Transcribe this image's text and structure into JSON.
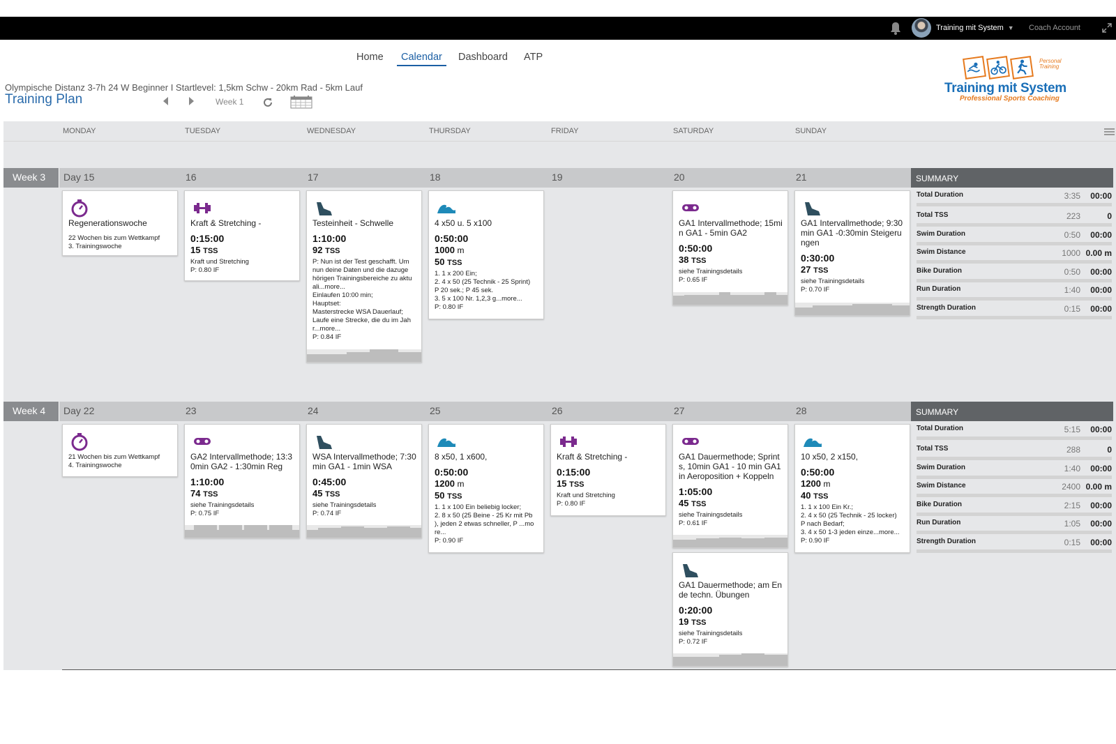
{
  "topbar": {
    "user_name": "Training mit System",
    "user_caret": "▼",
    "coach_link": "Coach Account",
    "icons": [
      "bell-icon",
      "expand-icon"
    ]
  },
  "nav": {
    "items": [
      "Home",
      "Calendar",
      "Dashboard",
      "ATP"
    ],
    "active": "Calendar"
  },
  "plan": {
    "subtitle": "Olympische Distanz 3-7h 24 W Beginner I Startlevel: 1,5km Schw - 20km Rad - 5km Lauf",
    "title": "Training Plan",
    "week_label": "Week 1"
  },
  "logo": {
    "text": "Training mit System",
    "tagline": "Professional Sports Coaching",
    "badge": "Personal\nTraining"
  },
  "colors": {
    "accent": "#1b5fa4",
    "strength": "#7b2a8e",
    "recovery": "#7b2a8e",
    "bike": "#7b2a8e",
    "run": "#2f4f5f",
    "swim": "#1e8ab8"
  },
  "days": [
    "MONDAY",
    "TUESDAY",
    "WEDNESDAY",
    "THURSDAY",
    "FRIDAY",
    "SATURDAY",
    "SUNDAY"
  ],
  "summary_label": "SUMMARY",
  "weeks": [
    {
      "label": "Week 3",
      "day_labels": [
        "Day 15",
        "16",
        "17",
        "18",
        "19",
        "20",
        "21"
      ],
      "cards": [
        {
          "day": 0,
          "icon": "stopwatch-icon",
          "title": "Regenerationswoche",
          "note": "22 Wochen bis zum Wettkampf\n3. Trainingswoche"
        },
        {
          "day": 1,
          "icon": "dumbbell-icon",
          "title": "Kraft & Stretching -",
          "duration": "0:15:00",
          "tss": "15",
          "tss_unit": "TSS",
          "desc": "Kraft und Stretching",
          "if": "P: 0.80 IF"
        },
        {
          "day": 2,
          "icon": "running-shoe-icon",
          "title": "Testeinheit - Schwelle",
          "duration": "1:10:00",
          "tss": "92",
          "tss_unit": "TSS",
          "desc": "P: Nun ist der Test geschafft. Um\nnun deine Daten und die dazuge\nhörigen Trainingsbereiche zu aktu\nali...more...\nEinlaufen 10:00 min;\nHauptset:\nMasterstrecke WSA Dauerlauf;\nLaufe eine Strecke, die du im Jah\nr...more...",
          "if": "P: 0.84 IF",
          "profile": [
            [
              0,
              0.6
            ],
            [
              0.35,
              0.8
            ],
            [
              0.55,
              1
            ],
            [
              0.8,
              0.8
            ]
          ]
        },
        {
          "day": 3,
          "icon": "swim-wave-icon",
          "title": "4 x50 u. 5 x100",
          "duration": "0:50:00",
          "value": "1000",
          "value_unit": "m",
          "tss": "50",
          "tss_unit": "TSS",
          "desc": "1. 1 x 200 Ein;\n2. 4 x 50 (25 Technik - 25 Sprint)\nP 20 sek.; P 45 sek.\n3. 5 x 100 Nr. 1,2,3 g...more...",
          "if": "P: 0.80 IF"
        },
        {
          "day": 5,
          "icon": "bike-chain-icon",
          "title": "GA1 Intervallmethode; 15mi\nn GA1 - 5min GA2",
          "duration": "0:50:00",
          "tss": "38",
          "tss_unit": "TSS",
          "desc": "siehe Trainingsdetails",
          "if": "P: 0.65 IF",
          "profile": [
            [
              0,
              0.7
            ],
            [
              0.1,
              0.8
            ],
            [
              0.4,
              1
            ],
            [
              0.5,
              0.8
            ],
            [
              0.8,
              1
            ],
            [
              0.9,
              0.8
            ]
          ]
        },
        {
          "day": 6,
          "icon": "running-shoe-icon",
          "title": "GA1 Intervallmethode; 9:30\nmin GA1 -0:30min Steigeru\nngen",
          "duration": "0:30:00",
          "tss": "27",
          "tss_unit": "TSS",
          "desc": "siehe Trainingsdetails",
          "if": "P: 0.70 IF",
          "profile": [
            [
              0,
              0.6
            ],
            [
              0.15,
              0.8
            ],
            [
              0.5,
              0.9
            ],
            [
              0.85,
              0.8
            ]
          ]
        }
      ],
      "summary": [
        {
          "label": "Total Duration",
          "planned": "3:35",
          "actual": "00:00"
        },
        {
          "label": "Total TSS",
          "planned": "223",
          "actual": "0"
        },
        {
          "label": "Swim Duration",
          "planned": "0:50",
          "actual": "00:00"
        },
        {
          "label": "Swim Distance",
          "planned": "1000",
          "actual": "0.00 m"
        },
        {
          "label": "Bike Duration",
          "planned": "0:50",
          "actual": "00:00"
        },
        {
          "label": "Run Duration",
          "planned": "1:40",
          "actual": "00:00"
        },
        {
          "label": "Strength Duration",
          "planned": "0:15",
          "actual": "00:00"
        }
      ]
    },
    {
      "label": "Week 4",
      "day_labels": [
        "Day 22",
        "23",
        "24",
        "25",
        "26",
        "27",
        "28"
      ],
      "cards": [
        {
          "day": 0,
          "icon": "stopwatch-icon",
          "title": "",
          "note": "21 Wochen bis zum Wettkampf\n4. Trainingswoche"
        },
        {
          "day": 1,
          "icon": "bike-chain-icon",
          "title": "GA2 Intervallmethode; 13:3\n0min GA2 - 1:30min Reg",
          "duration": "1:10:00",
          "tss": "74",
          "tss_unit": "TSS",
          "desc": "siehe Trainingsdetails",
          "if": "P: 0.75 IF",
          "profile": [
            [
              0,
              0.6
            ],
            [
              0.08,
              1
            ],
            [
              0.28,
              0.6
            ],
            [
              0.3,
              1
            ],
            [
              0.5,
              0.6
            ],
            [
              0.52,
              1
            ],
            [
              0.72,
              0.6
            ],
            [
              0.74,
              1
            ],
            [
              0.94,
              0.6
            ]
          ]
        },
        {
          "day": 2,
          "icon": "running-shoe-icon",
          "title": "WSA Intervallmethode; 7:30\nmin GA1 - 1min WSA",
          "duration": "0:45:00",
          "tss": "45",
          "tss_unit": "TSS",
          "desc": "siehe Trainingsdetails",
          "if": "P: 0.74 IF",
          "profile": [
            [
              0,
              0.6
            ],
            [
              0.1,
              0.8
            ],
            [
              0.3,
              0.9
            ],
            [
              0.5,
              0.8
            ],
            [
              0.7,
              0.9
            ],
            [
              0.9,
              0.8
            ]
          ]
        },
        {
          "day": 3,
          "icon": "swim-wave-icon",
          "title": "8 x50, 1 x600,",
          "duration": "0:50:00",
          "value": "1200",
          "value_unit": "m",
          "tss": "50",
          "tss_unit": "TSS",
          "desc": "1. 1 x 100 Ein beliebig locker;\n2. 8 x 50 (25 Beine - 25 Kr mit Pb\n), jeden 2 etwas schneller, P ...mo\nre...",
          "if": "P: 0.90 IF"
        },
        {
          "day": 4,
          "icon": "dumbbell-icon",
          "title": "Kraft & Stretching -",
          "duration": "0:15:00",
          "tss": "15",
          "tss_unit": "TSS",
          "desc": "Kraft und Stretching",
          "if": "P: 0.80 IF"
        },
        {
          "day": 5,
          "icon": "bike-chain-icon",
          "title": "GA1 Dauermethode; Sprint\ns, 10min GA1 - 10 min GA1\nin Aeroposition + Koppeln",
          "duration": "1:05:00",
          "tss": "45",
          "tss_unit": "TSS",
          "desc": "siehe Trainingsdetails",
          "if": "P: 0.61 IF",
          "profile": [
            [
              0,
              0.6
            ],
            [
              0.2,
              0.7
            ],
            [
              0.4,
              0.8
            ],
            [
              0.6,
              0.7
            ],
            [
              0.8,
              0.8
            ]
          ]
        },
        {
          "day": 6,
          "icon": "swim-wave-icon",
          "title": "10 x50, 2 x150,",
          "duration": "0:50:00",
          "value": "1200",
          "value_unit": "m",
          "tss": "40",
          "tss_unit": "TSS",
          "desc": "1. 1 x 100 Ein Kr.;\n2. 4 x 50 (25 Technik - 25 locker)\nP nach Bedarf;\n3. 4 x 50 1-3 jeden einze...more...",
          "if": "P: 0.90 IF"
        },
        {
          "day": 5,
          "slot": 1,
          "icon": "running-shoe-icon",
          "title": "GA1 Dauermethode; am En\nde techn. Übungen",
          "duration": "0:20:00",
          "tss": "19",
          "tss_unit": "TSS",
          "desc": "siehe Trainingsdetails",
          "if": "P: 0.72 IF",
          "profile": [
            [
              0,
              0.7
            ],
            [
              0.4,
              0.9
            ],
            [
              0.6,
              1
            ],
            [
              0.8,
              0.9
            ]
          ]
        }
      ],
      "summary": [
        {
          "label": "Total Duration",
          "planned": "5:15",
          "actual": "00:00"
        },
        {
          "label": "Total TSS",
          "planned": "288",
          "actual": "0"
        },
        {
          "label": "Swim Duration",
          "planned": "1:40",
          "actual": "00:00"
        },
        {
          "label": "Swim Distance",
          "planned": "2400",
          "actual": "0.00 m"
        },
        {
          "label": "Bike Duration",
          "planned": "2:15",
          "actual": "00:00"
        },
        {
          "label": "Run Duration",
          "planned": "1:05",
          "actual": "00:00"
        },
        {
          "label": "Strength Duration",
          "planned": "0:15",
          "actual": "00:00"
        }
      ]
    }
  ]
}
